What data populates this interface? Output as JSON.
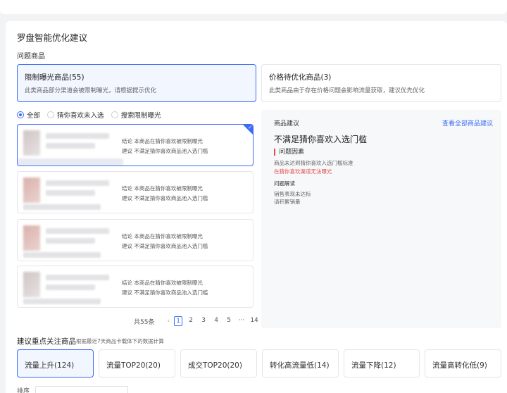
{
  "section_title": "罗盘智能优化建议",
  "subtitle": "问题商品",
  "problem_tabs": [
    {
      "title": "限制曝光商品(55)",
      "desc": "此类商品部分渠道会被限制曝光，请根据提示优化"
    },
    {
      "title": "价格待优化商品(3)",
      "desc": "此类商品由于存在价格问题会影响流量获取，建议优先优化"
    }
  ],
  "filters": [
    "全部",
    "猜你喜欢未入选",
    "搜索限制曝光"
  ],
  "products": [
    {
      "conclusion": "结论  本商品在猜你喜欢被限制曝光",
      "suggestion": "建议  不满足猜你喜欢商品池入选门槛"
    },
    {
      "conclusion": "结论  本商品在猜你喜欢被限制曝光",
      "suggestion": "建议  不满足猜你喜欢商品池入选门槛"
    },
    {
      "conclusion": "结论  本商品在猜你喜欢被限制曝光",
      "suggestion": "建议  不满足猜你喜欢商品池入选门槛"
    },
    {
      "conclusion": "结论  本商品在猜你喜欢被限制曝光",
      "suggestion": "建议  不满足猜你喜欢商品池入选门槛"
    }
  ],
  "pagination": {
    "total": "共55条",
    "pages": [
      "1",
      "2",
      "3",
      "4",
      "5",
      "···",
      "14"
    ],
    "current": "1"
  },
  "detail": {
    "header": "商品建议",
    "view_all": "查看全部商品建议",
    "headline": "不满足猜你喜欢入选门槛",
    "cause_title": "问题因素",
    "cause_desc": "商品未达到猜你喜欢入选门槛标准",
    "cause_red": "在猜你喜欢渠道无法曝光",
    "solution_title": "问题解读",
    "solution_lines": [
      "销售表现未达标",
      "请积累销量"
    ]
  },
  "focus": {
    "title": "建议重点关注商品",
    "note": "根据最近7天商品卡载体下的数据计算",
    "tabs": [
      "流量上升(124)",
      "流量TOP20(20)",
      "成交TOP20(20)",
      "转化高流量低(14)",
      "流量下降(12)",
      "流量高转化低(9)"
    ]
  },
  "sort_label": "排序",
  "colors": {
    "accent": "#3b6bf5",
    "warning": "#e34d4d"
  }
}
